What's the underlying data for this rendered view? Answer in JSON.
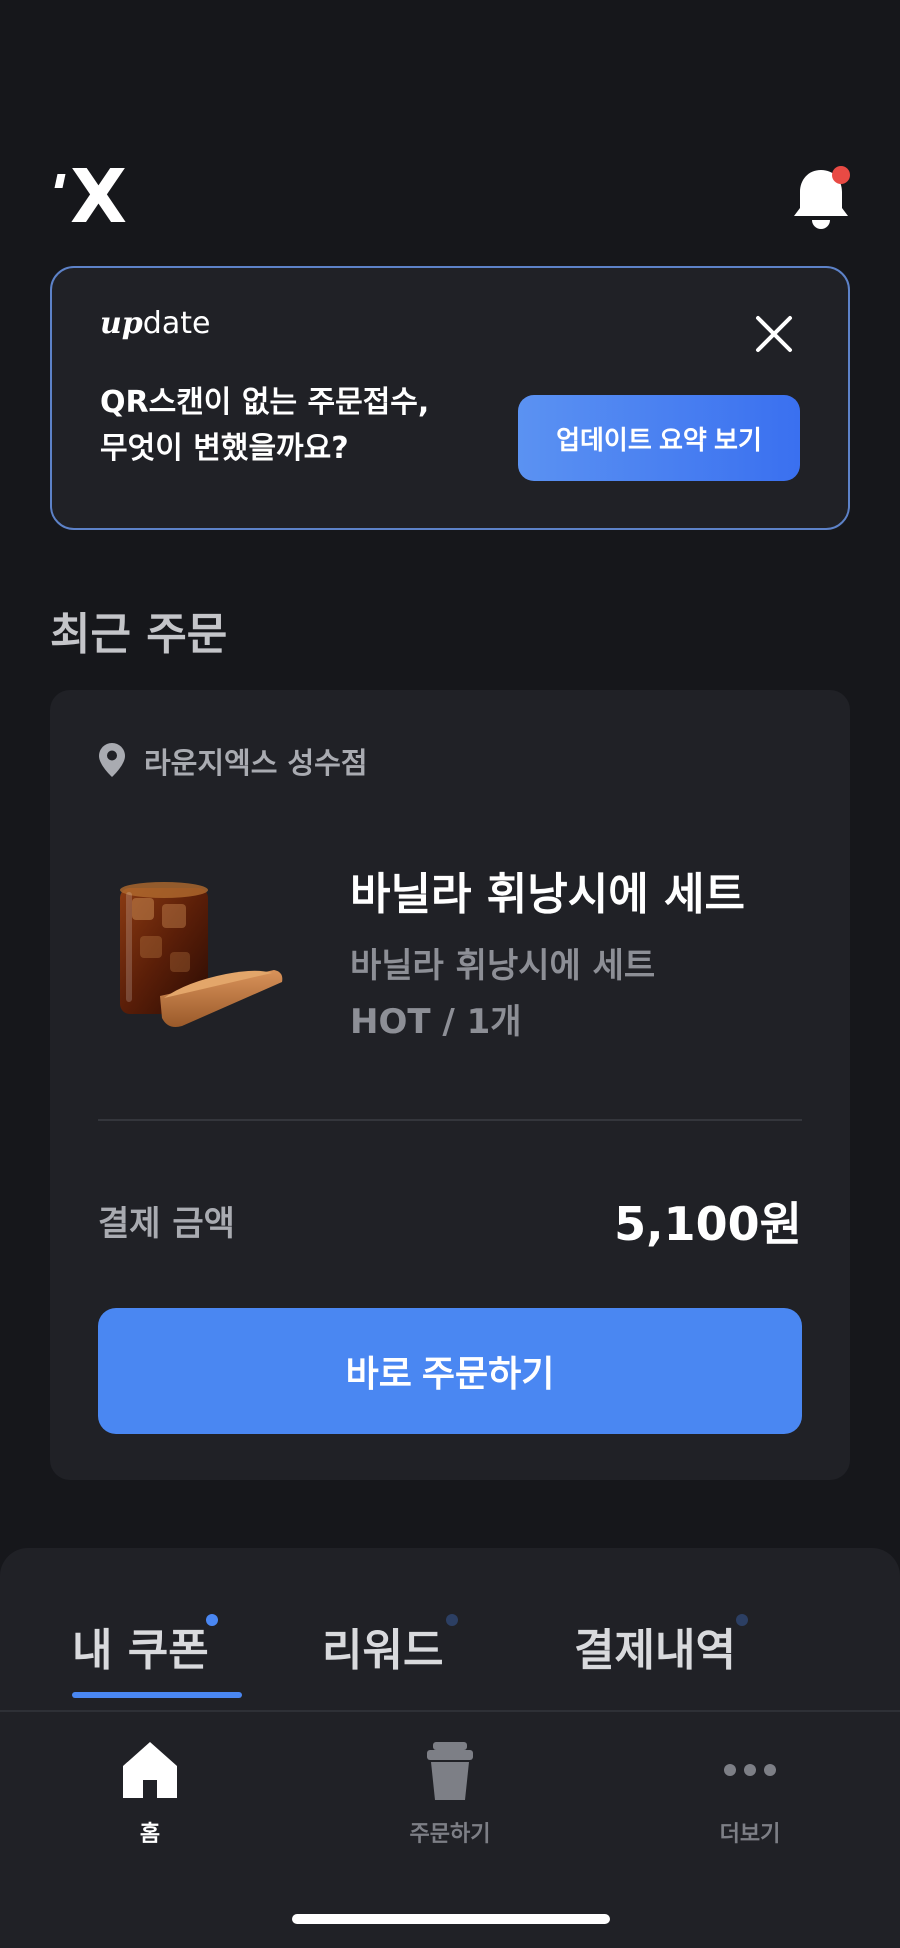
{
  "header": {
    "logo_text": "X",
    "notification_icon": "bell-icon",
    "has_notification": true
  },
  "banner": {
    "label_italic": "up",
    "label_rest": "date",
    "message": "QR스캔이 없는 주문접수,\n무엇이 변했을까요?",
    "button_label": "업데이트 요약 보기",
    "close_icon": "close-icon"
  },
  "recent_orders": {
    "title": "최근 주문",
    "store_name": "라운지엑스 성수점",
    "item_name": "바닐라 휘낭시에 세트",
    "item_desc": "바닐라 휘낭시에 세트",
    "item_option": "HOT / 1개",
    "payment_label": "결제 금액",
    "payment_amount": "5,100원",
    "order_button": "바로 주문하기"
  },
  "tabs": [
    {
      "label": "내 쿠폰",
      "active": true
    },
    {
      "label": "리워드",
      "active": false
    },
    {
      "label": "결제내역",
      "active": false
    }
  ],
  "nav": [
    {
      "label": "홈",
      "icon": "home-icon",
      "active": true
    },
    {
      "label": "주문하기",
      "icon": "cup-icon",
      "active": false
    },
    {
      "label": "더보기",
      "icon": "more-icon",
      "active": false
    }
  ],
  "colors": {
    "background": "#16171b",
    "card": "#202126",
    "accent": "#4a87f2",
    "notification_dot": "#e84a44"
  }
}
